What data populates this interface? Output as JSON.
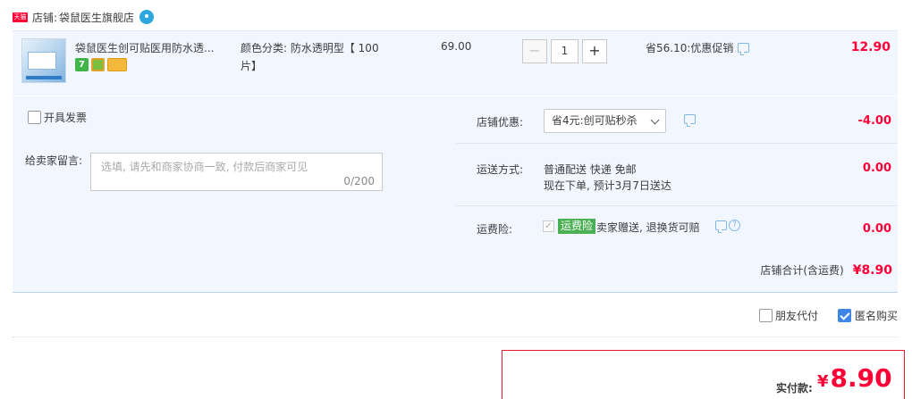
{
  "shop": {
    "badge": "天猫",
    "label": "店铺:",
    "name": "袋鼠医生旗舰店"
  },
  "item": {
    "title": "袋鼠医生创可贴医用防水透...",
    "icons": [
      "7-day-return-icon",
      "safety-icon",
      "card-icon"
    ],
    "icon_7_text": "7",
    "sku": "颜色分类: 防水透明型【 100片】",
    "price": "69.00",
    "quantity": "1",
    "minus_label": "−",
    "plus_label": "+",
    "promo": "省56.10:优惠促销",
    "subtotal": "12.90"
  },
  "options": {
    "invoice_label": "开具发票",
    "message_label": "给卖家留言:",
    "message_placeholder": "选填, 请先和商家协商一致, 付款后商家可见",
    "message_count": "0/200"
  },
  "shop_coupon": {
    "label": "店铺优惠:",
    "selected": "省4元:创可贴秒杀",
    "amount": "-4.00"
  },
  "shipping": {
    "label": "运送方式:",
    "line1": "普通配送 快递 免邮",
    "line2": "现在下单, 预计3月7日送达",
    "amount": "0.00"
  },
  "insurance": {
    "label": "运费险:",
    "badge": "运费险",
    "text": "卖家赠送, 退换货可赔",
    "help": "?",
    "amount": "0.00"
  },
  "shop_total": {
    "label": "店铺合计(含运费)",
    "value": "¥8.90"
  },
  "bottom": {
    "friend_pay": "朋友代付",
    "anonymous": "匿名购买"
  },
  "payment": {
    "label": "实付款:",
    "currency": "¥",
    "value": "8.90"
  },
  "colors": {
    "accent": "#ff0036",
    "panel_bg": "#f2f7ff",
    "check_blue": "#3d86e6"
  }
}
